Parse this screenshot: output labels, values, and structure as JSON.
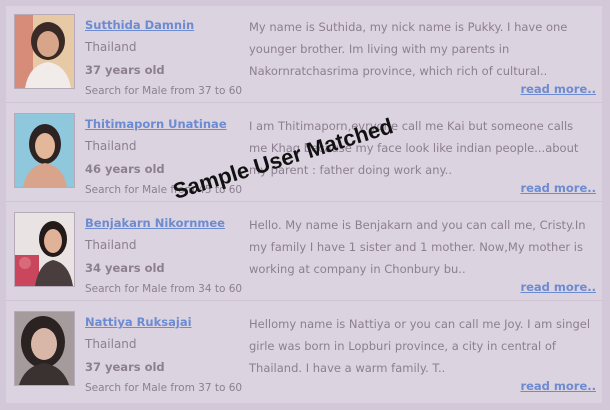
{
  "watermark": "Sample User Matched",
  "more_label": "read more..",
  "profiles": [
    {
      "name": "Sutthida Damnin",
      "country": "Thailand",
      "age": "37 years old",
      "search": "Search for Male from 37 to 60",
      "description": "My name is Suthida, my nick name is Pukky. I have one younger brother. Im living with my parents in Nakornratchasrima province, which rich of cultural.."
    },
    {
      "name": "Thitimaporn Unatinae",
      "country": "Thailand",
      "age": "46 years old",
      "search": "Search for Male from 45 to 60",
      "description": "I am Thitimaporn,evryone call me Kai but someone calls me Khag because my face look like indian people...about my parent : father doing work any.."
    },
    {
      "name": "Benjakarn Nikornmee",
      "country": "Thailand",
      "age": "34 years old",
      "search": "Search for Male from 34 to 60",
      "description": "Hello. My name is Benjakarn and you can call me, Cristy.In my family I have 1 sister and 1 mother. Now,My mother is working at company in Chonbury bu.."
    },
    {
      "name": "Nattiya Ruksajai",
      "country": "Thailand",
      "age": "37 years old",
      "search": "Search for Male from 37 to 60",
      "description": "Hellomy name is Nattiya or you can call me Joy. I am singel girle was born in Lopburi province, a city in central of Thailand. I have a warm family. T.."
    }
  ]
}
